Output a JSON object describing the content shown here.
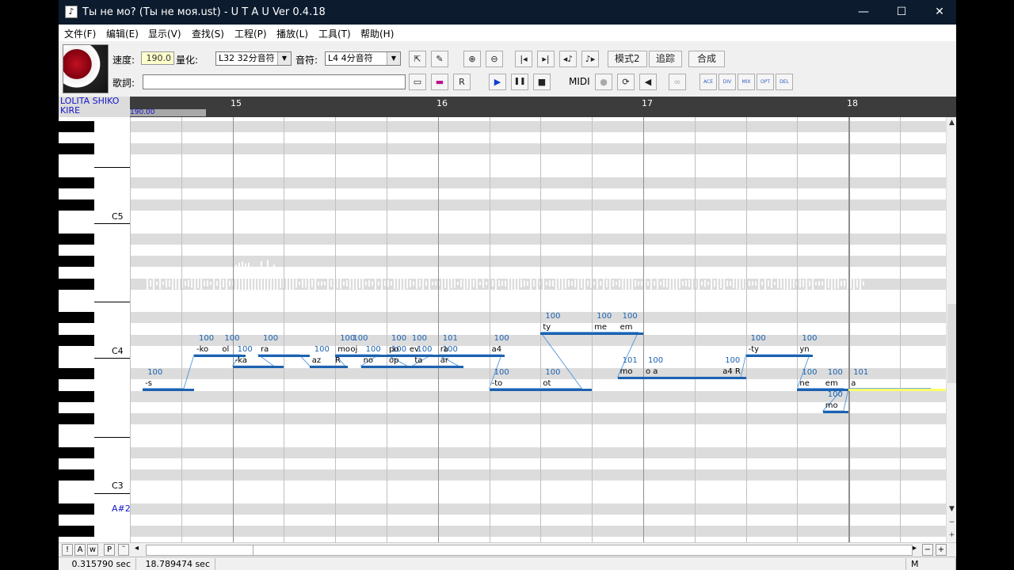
{
  "window": {
    "title": "Ты не мо? (Ты не моя.ust) - U T A U Ver 0.4.18",
    "icon_glyph": "♪",
    "minimize": "—",
    "maximize": "☐",
    "close": "✕"
  },
  "menu": [
    "文件(F)",
    "编辑(E)",
    "显示(V)",
    "查找(S)",
    "工程(P)",
    "播放(L)",
    "工具(T)",
    "帮助(H)"
  ],
  "toolbar": {
    "tempo_label": "速度:",
    "tempo_value": "190.0",
    "quantize_label": "量化:",
    "quantize_value": "L32 32分音符",
    "note_label": "音符:",
    "note_value": "L4 4分音符",
    "lyric_label": "歌詞:",
    "lyric_value": "",
    "mode_btn": "模式2",
    "trace_btn": "追踪",
    "synth_btn": "合成",
    "midi_label": "MIDI",
    "icons": {
      "select": "⇱",
      "pencil": "✎",
      "zoom_in": "⊕",
      "zoom_out": "⊖",
      "to_start": "|◂",
      "to_end": "▸|",
      "prev_note": "◂♪",
      "next_note": "♪▸",
      "insert_rest": "▭",
      "delete_rest": "▬",
      "replace_r": "R",
      "play": "▶",
      "pause": "❚❚",
      "stop": "■",
      "record": "●",
      "loop": "⟳",
      "mute": "◀",
      "link": "∞",
      "t1": "ACE",
      "t2": "DIV",
      "t3": "MIX",
      "t4": "OPT",
      "t5": "DEL"
    }
  },
  "track": {
    "singer_name": "LOLITA SHIKO KIRE",
    "tempo_marker": "190.00",
    "measures": [
      "15",
      "16",
      "17",
      "18"
    ]
  },
  "piano": {
    "labels": [
      {
        "text": "C5",
        "row": 8
      },
      {
        "text": "C4",
        "row": 20
      },
      {
        "text": "C3",
        "row": 32
      },
      {
        "text": "A#2",
        "row": 34
      }
    ]
  },
  "notes": [
    {
      "lyric": "-s",
      "vel": "100",
      "start": 0.25,
      "len": 1,
      "row": 23
    },
    {
      "lyric": "-ko",
      "vel": "100",
      "start": 1.25,
      "len": 0.75,
      "row": 20
    },
    {
      "lyric": "ol",
      "vel": "100",
      "start": 1.75,
      "len": 0.5,
      "row": 20
    },
    {
      "lyric": "-ka",
      "vel": "100",
      "start": 2.0,
      "len": 1,
      "row": 21
    },
    {
      "lyric": "ra",
      "vel": "100",
      "start": 2.5,
      "len": 1,
      "row": 20
    },
    {
      "lyric": "az",
      "vel": "100",
      "start": 3.5,
      "len": 0.5,
      "row": 21
    },
    {
      "lyric": "R",
      "vel": "",
      "start": 3.95,
      "len": 0.3,
      "row": 21
    },
    {
      "lyric": "mo",
      "vel": "100",
      "start": 4.0,
      "len": 1,
      "row": 20
    },
    {
      "lyric": "oj",
      "vel": "100",
      "start": 4.25,
      "len": 0.75,
      "row": 20
    },
    {
      "lyric": "no",
      "vel": "100",
      "start": 4.5,
      "len": 1,
      "row": 21
    },
    {
      "lyric": "op",
      "vel": "100",
      "start": 5.0,
      "len": 0.5,
      "row": 21
    },
    {
      "lyric": "po",
      "vel": "100",
      "start": 5.0,
      "len": 0.6,
      "row": 20
    },
    {
      "lyric": "ev",
      "vel": "100",
      "start": 5.4,
      "len": 0.6,
      "row": 20
    },
    {
      "lyric": "ta",
      "vel": "100",
      "start": 5.5,
      "len": 1,
      "row": 21
    },
    {
      "lyric": "ar",
      "vel": "100",
      "start": 6.0,
      "len": 0.5,
      "row": 21
    },
    {
      "lyric": "ra",
      "vel": "101",
      "start": 6.0,
      "len": 1,
      "row": 20
    },
    {
      "lyric": "a4",
      "vel": "100",
      "start": 7.0,
      "len": 0.3,
      "row": 20
    },
    {
      "lyric": "-to",
      "vel": "100",
      "start": 7.0,
      "len": 1,
      "row": 23
    },
    {
      "lyric": "ot",
      "vel": "100",
      "start": 8.0,
      "len": 1,
      "row": 23
    },
    {
      "lyric": "ty",
      "vel": "100",
      "start": 8.0,
      "len": 1,
      "row": 18
    },
    {
      "lyric": "me",
      "vel": "100",
      "start": 9.0,
      "len": 0.6,
      "row": 18
    },
    {
      "lyric": "em",
      "vel": "100",
      "start": 9.5,
      "len": 0.5,
      "row": 18
    },
    {
      "lyric": "mo",
      "vel": "101",
      "start": 9.5,
      "len": 0.6,
      "row": 22
    },
    {
      "lyric": "o a",
      "vel": "100",
      "start": 10.0,
      "len": 2,
      "row": 22
    },
    {
      "lyric": "a4 R",
      "vel": "100",
      "start": 11.5,
      "len": 0.5,
      "row": 22
    },
    {
      "lyric": "-ty",
      "vel": "100",
      "start": 12.0,
      "len": 1,
      "row": 20
    },
    {
      "lyric": "yn",
      "vel": "100",
      "start": 13.0,
      "len": 0.3,
      "row": 20
    },
    {
      "lyric": "ne",
      "vel": "100",
      "start": 13.0,
      "len": 0.5,
      "row": 23
    },
    {
      "lyric": "em",
      "vel": "100",
      "start": 13.5,
      "len": 0.5,
      "row": 23
    },
    {
      "lyric": "mo",
      "vel": "100",
      "start": 13.5,
      "len": 0.5,
      "row": 25
    },
    {
      "lyric": "a",
      "vel": "101",
      "start": 14.0,
      "len": 2,
      "row": 23,
      "selected": true
    }
  ],
  "status": {
    "time1": "0.315790 sec",
    "time2": "18.789474 sec",
    "mode": "M"
  },
  "bottom_modes": [
    "!",
    "A",
    "w",
    "P",
    "˜"
  ],
  "scroll": {
    "up": "▲",
    "down": "▼",
    "left": "◂",
    "right": "▸",
    "minus": "−",
    "plus": "+"
  }
}
